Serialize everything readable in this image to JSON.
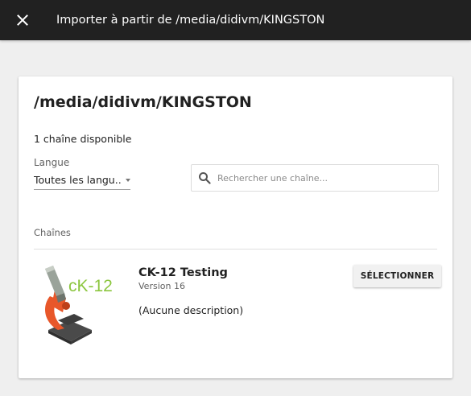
{
  "appbar": {
    "title": "Importer à partir de /media/didivm/KINGSTON",
    "close_icon": "close-icon",
    "background": "#212121"
  },
  "drive": {
    "title": "/media/didivm/KINGSTON",
    "available_count": "1 chaîne disponible"
  },
  "filters": {
    "language_label": "Langue",
    "language_value": "Toutes les langu...",
    "search_placeholder": "Rechercher une chaîne...",
    "search_value": "",
    "search_icon": "search-icon"
  },
  "channels": {
    "section_label": "Chaînes",
    "items": [
      {
        "title": "CK-12 Testing",
        "version": "Version 16",
        "description": "(Aucune description)",
        "select_label": "SÉLECTIONNER",
        "thumbnail_text": "cK-12",
        "thumbnail_colors": {
          "accent": "#e8572a",
          "green": "#8cc63f"
        }
      }
    ]
  }
}
